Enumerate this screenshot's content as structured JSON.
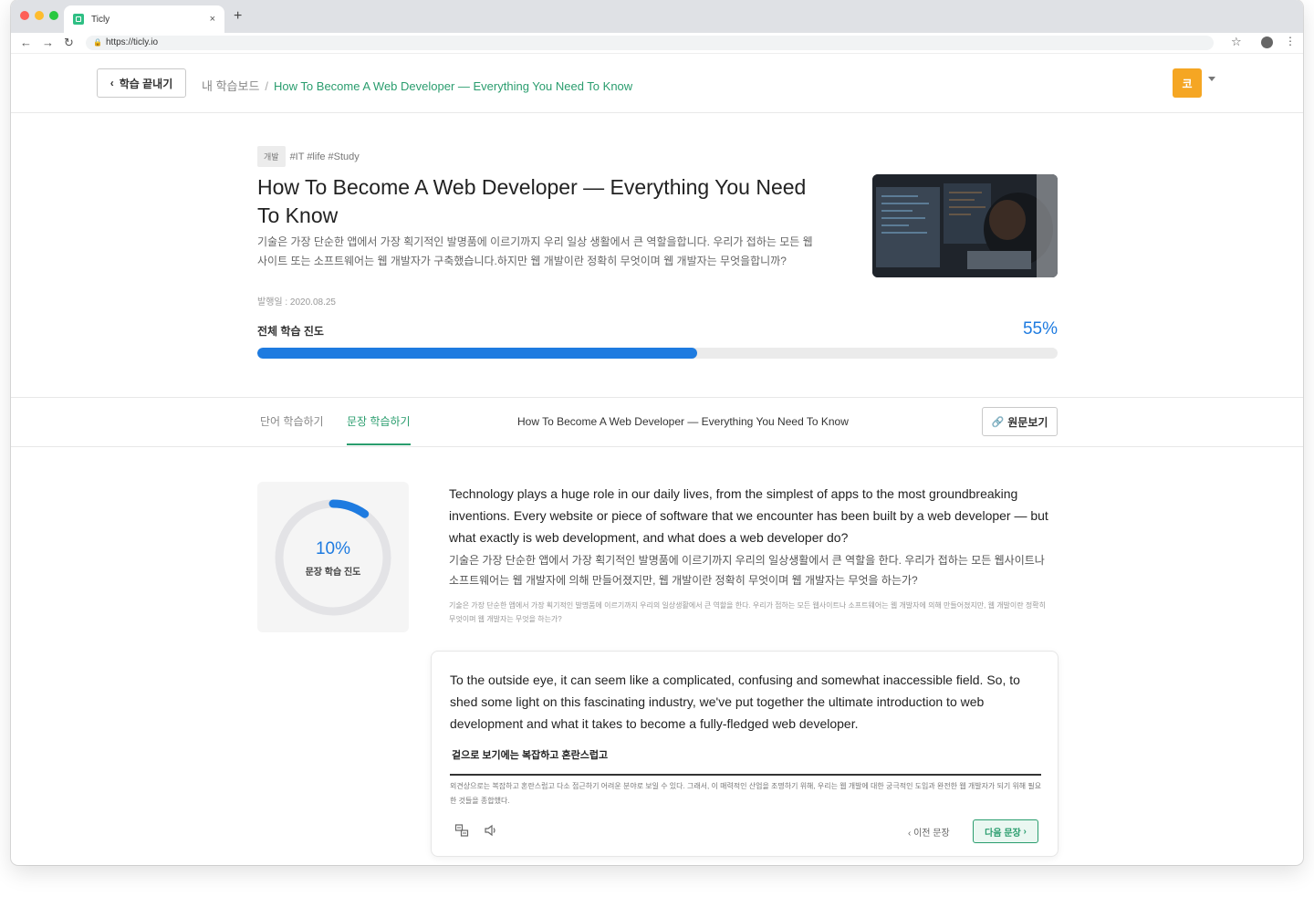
{
  "browser": {
    "tab_title": "Ticly",
    "tab_close": "×",
    "new_tab": "+",
    "url": "https://ticly.io"
  },
  "header": {
    "exit_label": "학습 끝내기",
    "breadcrumb_root": "내 학습보드",
    "breadcrumb_sep": "/",
    "breadcrumb_current": "How To Become A Web Developer — Everything You Need To Know",
    "avatar_letter": "코"
  },
  "article": {
    "category": "개발",
    "hashtags": "#IT #life #Study",
    "title": "How To Become A Web Developer — Everything You Need To Know",
    "description": "기술은 가장 단순한 앱에서 가장 획기적인 발명품에 이르기까지 우리 일상 생활에서 큰 역할을합니다. 우리가 접하는 모든 웹 사이트 또는 소프트웨어는 웹 개발자가 구축했습니다.하지만 웹 개발이란 정확히 무엇이며 웹 개발자는 무엇을합니까?",
    "date": "발행일 : 2020.08.25",
    "progress_label": "전체 학습 진도",
    "progress_text": "55%",
    "progress_value": 0.55
  },
  "tabs": {
    "items": [
      "단어 학습하기",
      "문장 학습하기"
    ],
    "active_index": 1,
    "title": "How To Become A Web Developer — Everything You Need To Know",
    "original_label": "원문보기"
  },
  "sentence_progress": {
    "percent_text": "10%",
    "value": 0.1,
    "label": "문장 학습 진도"
  },
  "sentence1": {
    "en": "Technology plays a huge role in our daily lives, from the simplest of apps to the most groundbreaking inventions. Every website or piece of software that we encounter has been built by a web developer — but what exactly is web development, and what does a web developer do?",
    "ko_user": "기술은 가장 단순한 앱에서 가장 획기적인 발명품에 이르기까지 우리의 일상생활에서 큰 역할을 한다. 우리가 접하는 모든 웹사이트나 소프트웨어는 웹 개발자에 의해 만들어졌지만, 웹 개발이란 정확히 무엇이며 웹 개발자는 무엇을 하는가?",
    "ko_machine": "기술은 가장 단순한 앱에서 가장 획기적인 발명품에 이르기까지 우리의 일상생활에서 큰 역할을 한다. 우리가 접하는 모든 웹사이트나 소프트웨어는 웹 개발자에 의해 만들어졌지만, 웹 개발이란 정확히 무엇이며 웹 개발자는 무엇을 하는가?"
  },
  "sentence2": {
    "en": "To the outside eye, it can seem like a complicated, confusing and somewhat inaccessible field. So, to shed some light on this fascinating industry, we've put together the ultimate introduction to web development and what it takes to become a fully-fledged web developer.",
    "input_value": "겉으로 보기에는 복잡하고 혼란스럽고",
    "ko_machine": "외견상으로는 복잡하고 혼란스럽고 다소 접근하기 어려운 분야로 보일 수 있다. 그래서, 이 매력적인 산업을 조명하기 위해, 우리는 웹 개발에 대한 궁극적인 도입과 완전한 웹 개발자가 되기 위해 필요한 것들을 종합했다.",
    "prev_label": "이전 문장",
    "next_label": "다음 문장"
  },
  "colors": {
    "accent_green": "#2a9d6e",
    "progress_blue": "#1e7be0",
    "avatar_orange": "#f5a623"
  },
  "icons": [
    "back-arrow-icon",
    "forward-arrow-icon",
    "reload-icon",
    "lock-icon",
    "star-icon",
    "profile-icon",
    "menu-icon",
    "chevron-left-icon",
    "link-icon",
    "translate-icon",
    "speaker-icon",
    "chevron-right-icon"
  ]
}
